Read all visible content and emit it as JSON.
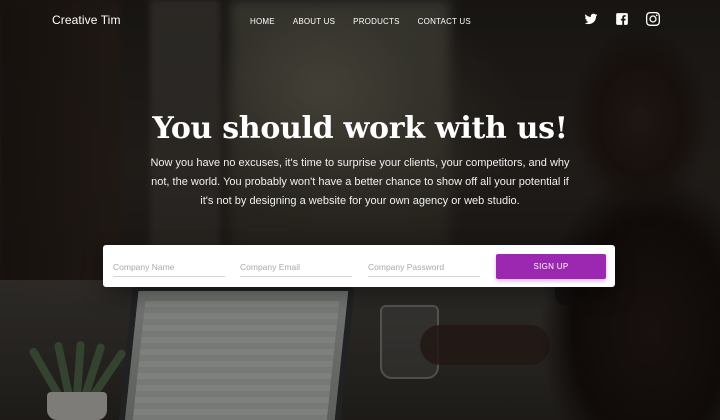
{
  "brand": {
    "name": "Creative Tim"
  },
  "nav": {
    "links": [
      {
        "label": "HOME"
      },
      {
        "label": "ABOUT US"
      },
      {
        "label": "PRODUCTS"
      },
      {
        "label": "CONTACT US"
      }
    ]
  },
  "social": {
    "icons": [
      "twitter-icon",
      "facebook-icon",
      "instagram-icon"
    ]
  },
  "hero": {
    "title": "You should work with us!",
    "subtitle": "Now you have no excuses, it's time to surprise your clients, your competitors, and why not, the world. You probably won't have a better chance to show off all your potential if it's not by designing a website for your own agency or web studio."
  },
  "form": {
    "company_name_placeholder": "Company Name",
    "company_email_placeholder": "Company Email",
    "company_password_placeholder": "Company Password",
    "signup_label": "SIGN UP"
  },
  "colors": {
    "accent": "#9c27b0",
    "card_bg": "#ffffff",
    "text_light": "#ffffff"
  }
}
